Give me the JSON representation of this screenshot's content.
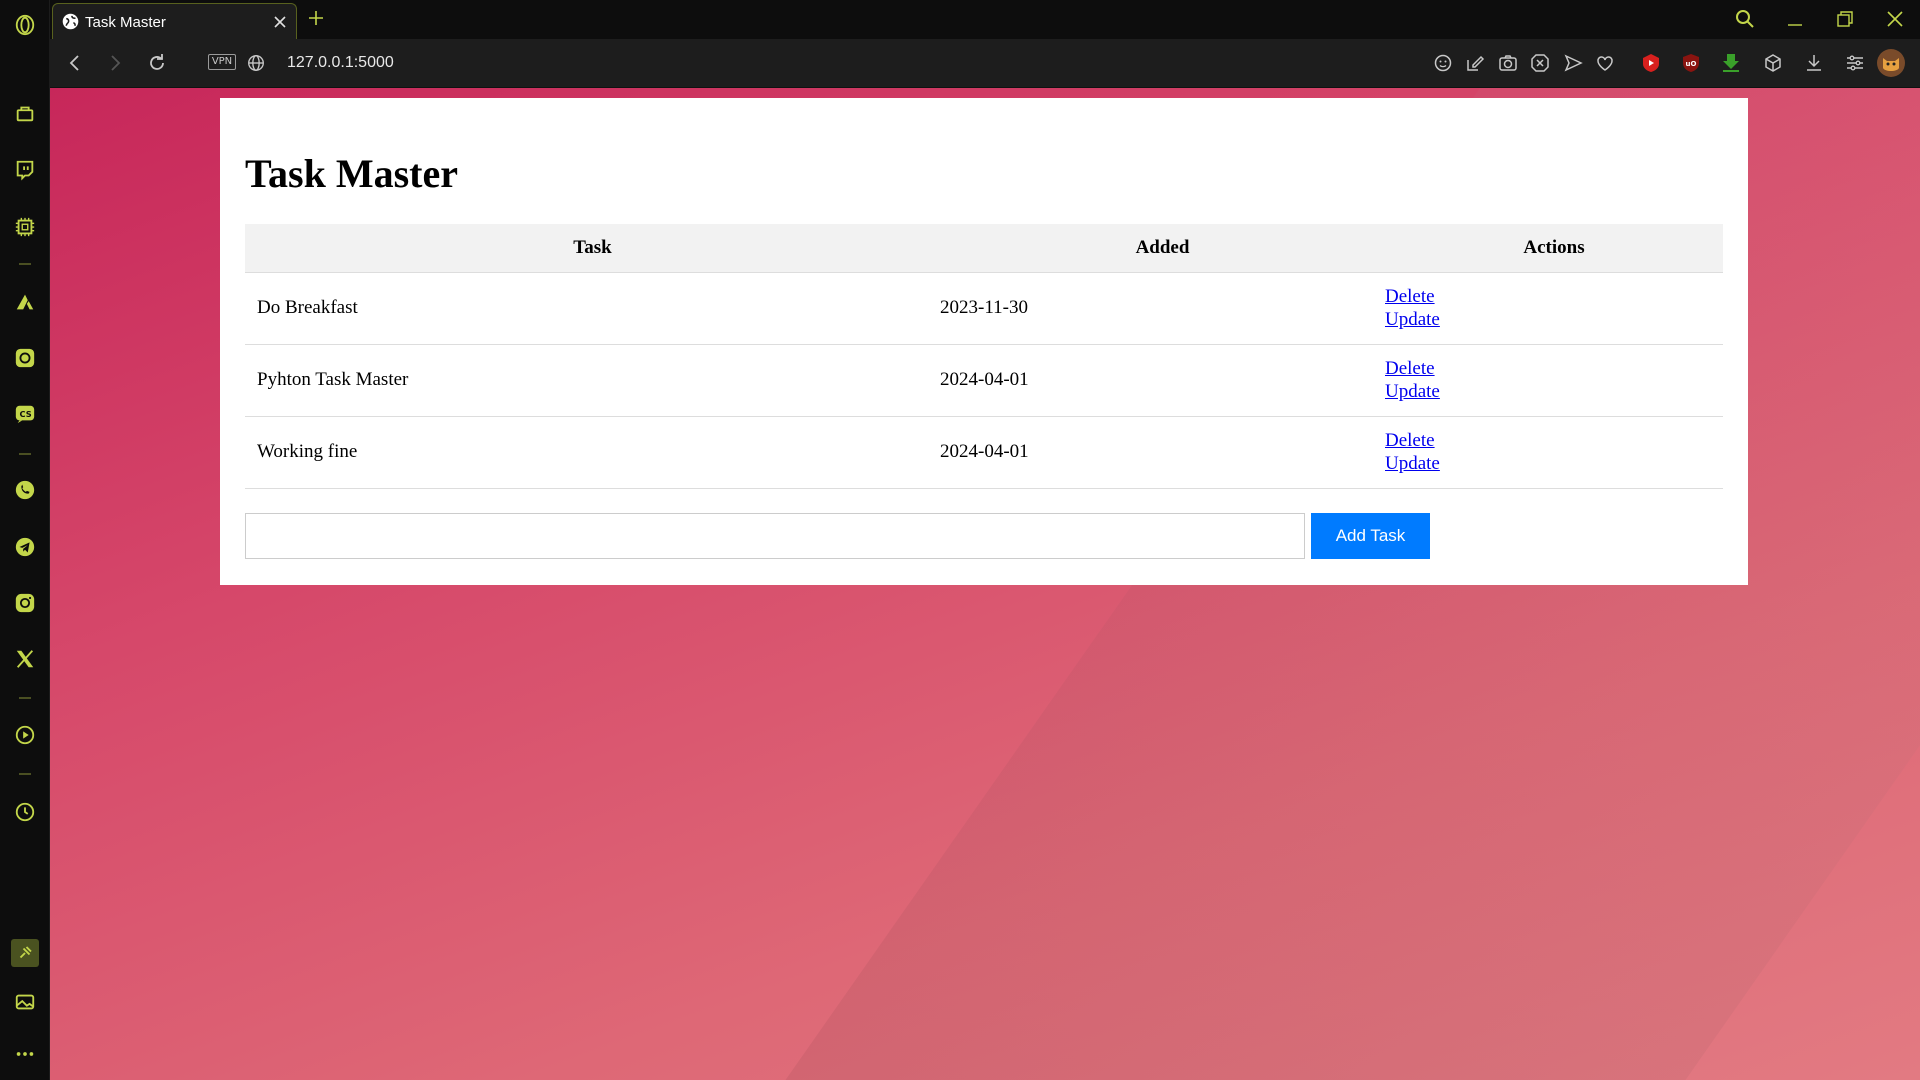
{
  "browser": {
    "tab_title": "Task Master",
    "url": "127.0.0.1:5000",
    "vpn_label": "VPN",
    "accent": "#c3d64a",
    "sidebar_icons": [
      "opera-logo-icon",
      "shopping-icon",
      "twitch-icon",
      "cpu-icon",
      "aria-icon",
      "chatgpt-icon",
      "chatgpt-cs-icon",
      "whatsapp-icon",
      "telegram-icon",
      "instagram-icon",
      "x-twitter-icon",
      "player-icon",
      "history-icon",
      "pinboard-icon",
      "gallery-icon",
      "more-icon"
    ],
    "extension_icons": [
      "emoji-icon",
      "snapshot-edit-icon",
      "camera-icon",
      "block-icon",
      "send-icon",
      "heart-icon",
      "youtube-icon",
      "ublock-icon",
      "download-arrow-icon",
      "cube-icon",
      "downloads-icon",
      "easy-setup-icon",
      "profile-avatar-icon"
    ]
  },
  "page": {
    "title": "Task Master",
    "table": {
      "headers": [
        "Task",
        "Added",
        "Actions"
      ],
      "rows": [
        {
          "task": "Do Breakfast",
          "added": "2023-11-30",
          "delete": "Delete",
          "update": "Update"
        },
        {
          "task": "Pyhton Task Master",
          "added": "2024-04-01",
          "delete": "Delete",
          "update": "Update"
        },
        {
          "task": "Working fine",
          "added": "2024-04-01",
          "delete": "Delete",
          "update": "Update"
        }
      ]
    },
    "input_value": "",
    "add_button": "Add Task",
    "button_color": "#007bff",
    "link_color": "#0000ee"
  }
}
